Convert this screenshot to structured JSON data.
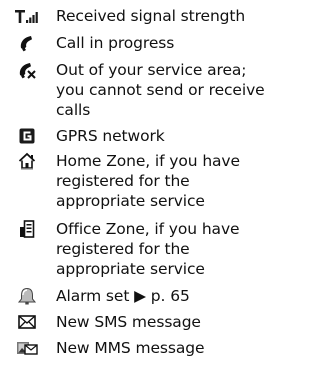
{
  "legend": {
    "items": [
      {
        "icon": "signal-strength-icon",
        "label": "Received signal strength"
      },
      {
        "icon": "call-in-progress-icon",
        "label": "Call in progress"
      },
      {
        "icon": "out-of-service-icon",
        "label": "Out of your service area;\nyou cannot send or receive\ncalls"
      },
      {
        "icon": "gprs-icon",
        "label": "GPRS network"
      },
      {
        "icon": "home-zone-icon",
        "label": "Home Zone, if you have\nregistered for the\nappropriate service"
      },
      {
        "icon": "office-zone-icon",
        "label": "Office Zone, if you have\nregistered for the\nappropriate service"
      },
      {
        "icon": "alarm-icon",
        "label": "Alarm set ▶ p. 65"
      },
      {
        "icon": "sms-envelope-icon",
        "label": "New SMS message"
      },
      {
        "icon": "mms-icon",
        "label": "New MMS message"
      }
    ]
  }
}
